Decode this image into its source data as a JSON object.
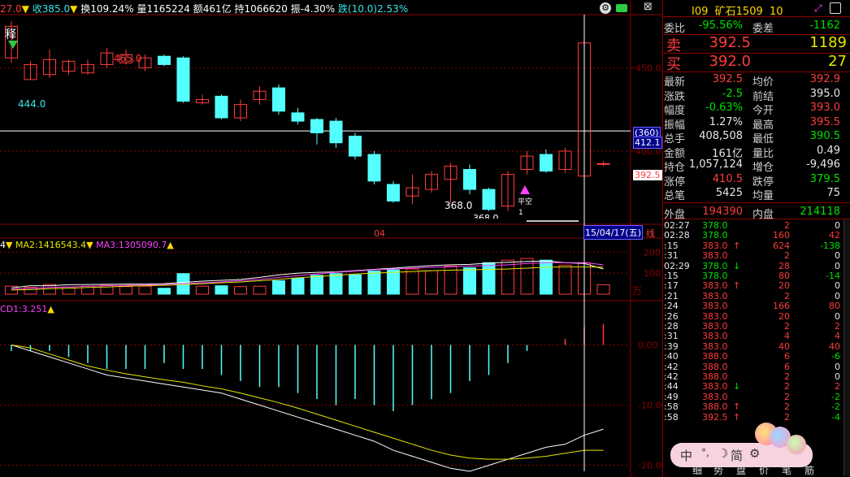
{
  "topbar": {
    "prefix": "27.0",
    "close": "收385.0",
    "turnover": "换109.24%",
    "volume": "量1165224",
    "amount": "额461亿",
    "hold": "持1066620",
    "amplitude": "振-4.30%",
    "change": "跌(10.0)2.53%"
  },
  "chart_data": {
    "type": "candlestick",
    "price_axis_ticks": [
      "450.0",
      "400.0"
    ],
    "price_ylim": [
      358,
      482
    ],
    "annotations": {
      "high": "465.0",
      "low_left": "444.0",
      "low_mid": "368.0",
      "low_cut": "368.0",
      "marker_text": "平空",
      "marker_sub": "1",
      "top_left_label": "释",
      "x_month": "04",
      "date_label": "15/04/17(五)",
      "period_label": "线"
    },
    "crosshair": {
      "price_tag": "412.1",
      "count_tag": "(360)",
      "last_price_tag": "392.5"
    },
    "candles": [
      {
        "o": 456,
        "c": 475,
        "h": 478,
        "l": 453
      },
      {
        "o": 443,
        "c": 452,
        "h": 454,
        "l": 443
      },
      {
        "o": 446,
        "c": 455,
        "h": 461,
        "l": 444
      },
      {
        "o": 448,
        "c": 454,
        "h": 455,
        "l": 446
      },
      {
        "o": 447,
        "c": 452,
        "h": 455,
        "l": 446
      },
      {
        "o": 452,
        "c": 459,
        "h": 462,
        "l": 450
      },
      {
        "o": 453,
        "c": 458,
        "h": 461,
        "l": 452
      },
      {
        "o": 450,
        "c": 456,
        "h": 458,
        "l": 448
      },
      {
        "o": 457,
        "c": 452,
        "h": 458,
        "l": 451
      },
      {
        "o": 456,
        "c": 430,
        "h": 457,
        "l": 429
      },
      {
        "o": 429,
        "c": 431,
        "h": 434,
        "l": 428
      },
      {
        "o": 433,
        "c": 420,
        "h": 434,
        "l": 419
      },
      {
        "o": 420,
        "c": 428,
        "h": 431,
        "l": 418
      },
      {
        "o": 431,
        "c": 436,
        "h": 439,
        "l": 428
      },
      {
        "o": 438,
        "c": 424,
        "h": 440,
        "l": 422
      },
      {
        "o": 423,
        "c": 418,
        "h": 426,
        "l": 416
      },
      {
        "o": 419,
        "c": 411,
        "h": 420,
        "l": 404
      },
      {
        "o": 418,
        "c": 405,
        "h": 420,
        "l": 402
      },
      {
        "o": 409,
        "c": 397,
        "h": 411,
        "l": 395
      },
      {
        "o": 398,
        "c": 382,
        "h": 400,
        "l": 380
      },
      {
        "o": 380,
        "c": 370,
        "h": 382,
        "l": 369
      },
      {
        "o": 373,
        "c": 378,
        "h": 386,
        "l": 368
      },
      {
        "o": 377,
        "c": 386,
        "h": 388,
        "l": 375
      },
      {
        "o": 383,
        "c": 391,
        "h": 393,
        "l": 369
      },
      {
        "o": 389,
        "c": 377,
        "h": 392,
        "l": 374
      },
      {
        "o": 377,
        "c": 365,
        "h": 378,
        "l": 364
      },
      {
        "o": 367,
        "c": 386,
        "h": 388,
        "l": 364
      },
      {
        "o": 389,
        "c": 397,
        "h": 400,
        "l": 386
      },
      {
        "o": 398,
        "c": 388,
        "h": 401,
        "l": 387
      },
      {
        "o": 389,
        "c": 400,
        "h": 402,
        "l": 387
      },
      {
        "o": 385,
        "c": 465,
        "h": 475,
        "l": 358
      },
      {
        "o": 392.5,
        "c": 392.5,
        "h": 394,
        "l": 391
      }
    ],
    "volume_header": {
      "ma1": "4",
      "ma2": "MA2:1416543.4",
      "ma3": "MA3:1305090.7"
    },
    "volume_axis_ticks": [
      "200",
      "100",
      "万"
    ],
    "volume_ylim": [
      0,
      240
    ],
    "volumes": [
      38,
      32,
      46,
      34,
      38,
      42,
      36,
      38,
      28,
      98,
      38,
      40,
      36,
      38,
      64,
      76,
      90,
      98,
      92,
      110,
      116,
      120,
      112,
      134,
      126,
      150,
      162,
      170,
      162,
      138,
      150,
      45
    ],
    "vol_ma_a": [
      30,
      40,
      40,
      45,
      46,
      47,
      48,
      48,
      50,
      56,
      62,
      66,
      70,
      80,
      92,
      100,
      104,
      106,
      112,
      118,
      124,
      130,
      136,
      140,
      142,
      148,
      152,
      156,
      158,
      150,
      146,
      120
    ],
    "vol_ma_b": [
      24,
      28,
      32,
      34,
      38,
      40,
      42,
      44,
      46,
      50,
      54,
      58,
      64,
      70,
      80,
      88,
      96,
      104,
      110,
      116,
      120,
      124,
      128,
      130,
      134,
      136,
      140,
      146,
      150,
      150,
      150,
      140
    ],
    "vol_ma_c": [
      20,
      22,
      26,
      28,
      32,
      34,
      38,
      40,
      42,
      46,
      50,
      54,
      58,
      64,
      70,
      78,
      84,
      90,
      96,
      100,
      104,
      108,
      112,
      114,
      116,
      118,
      120,
      124,
      128,
      130,
      130,
      128
    ],
    "macd_header": "CD1:3.251",
    "macd_axis_ticks": [
      "0.00",
      "-10.00",
      "-20.00"
    ],
    "macd_ylim": [
      -21,
      6
    ],
    "macd_hist": [
      -1,
      -1,
      -1,
      -2,
      -3,
      -4,
      -4,
      -4,
      -3,
      -4,
      -4,
      -5,
      -6,
      -7,
      -7,
      -8,
      -9,
      -10,
      -9,
      -10,
      -11,
      -10,
      -9,
      -8,
      -6,
      -5,
      -3,
      -1,
      0,
      1,
      3,
      3.5
    ],
    "macd_dif": [
      0,
      -1,
      -2,
      -3,
      -4,
      -5,
      -5.5,
      -6,
      -6.5,
      -7,
      -7.5,
      -8,
      -9,
      -10,
      -11,
      -12,
      -13,
      -14,
      -15,
      -16,
      -17.5,
      -18.5,
      -19.5,
      -20.5,
      -21,
      -20,
      -19,
      -18,
      -17,
      -16.5,
      -15,
      -14
    ],
    "macd_dea": [
      0,
      -0.5,
      -1.5,
      -2.5,
      -3.5,
      -4.2,
      -4.8,
      -5.3,
      -5.8,
      -6.2,
      -6.8,
      -7.3,
      -8,
      -8.8,
      -9.6,
      -10.5,
      -11.5,
      -12.5,
      -13.5,
      -14.5,
      -15.5,
      -16.5,
      -17.5,
      -18.3,
      -18.8,
      -19,
      -19,
      -18.8,
      -18.5,
      -18,
      -17.5,
      -17.5
    ]
  },
  "quote": {
    "symbol": "I09",
    "name": "矿石1509",
    "flag": "10",
    "weibi_label": "委比",
    "weibi": "-95.56%",
    "weicha_label": "委差",
    "weicha": "-1162",
    "sell_label": "卖",
    "sell_price": "392.5",
    "sell_qty": "1189",
    "buy_label": "买",
    "buy_price": "392.0",
    "buy_qty": "27",
    "stats": [
      {
        "l1": "最新",
        "v1": "392.5",
        "c1": "red",
        "l2": "均价",
        "v2": "392.9",
        "c2": "red"
      },
      {
        "l1": "涨跌",
        "v1": "-2.5",
        "c1": "green",
        "l2": "前结",
        "v2": "395.0",
        "c2": "white"
      },
      {
        "l1": "幅度",
        "v1": "-0.63%",
        "c1": "green",
        "l2": "今开",
        "v2": "393.0",
        "c2": "red"
      },
      {
        "l1": "振幅",
        "v1": "1.27%",
        "c1": "white",
        "l2": "最高",
        "v2": "395.5",
        "c2": "red"
      },
      {
        "l1": "总手",
        "v1": "408,508",
        "c1": "white",
        "l2": "最低",
        "v2": "390.5",
        "c2": "green"
      },
      {
        "l1": "金额",
        "v1": "161亿",
        "c1": "white",
        "l2": "量比",
        "v2": "0.49",
        "c2": "white"
      },
      {
        "l1": "持仓",
        "v1": "1,057,124",
        "c1": "white",
        "l2": "增仓",
        "v2": "-9,496",
        "c2": "white"
      },
      {
        "l1": "涨停",
        "v1": "410.5",
        "c1": "red",
        "l2": "跌停",
        "v2": "379.5",
        "c2": "green"
      },
      {
        "l1": "总笔",
        "v1": "5425",
        "c1": "white",
        "l2": "均量",
        "v2": "75",
        "c2": "white"
      }
    ],
    "outer_label": "外盘",
    "outer": "194390",
    "inner_label": "内盘",
    "inner": "214118"
  },
  "ticks": [
    {
      "t": "02:27",
      "p": "378.0",
      "a": "",
      "q": "2",
      "d": "0",
      "pc": "green",
      "dc": "white"
    },
    {
      "t": "02:28",
      "p": "378.0",
      "a": "",
      "q": "160",
      "d": "42",
      "pc": "green",
      "dc": "red"
    },
    {
      "t": ":15",
      "p": "383.0",
      "a": "↑",
      "q": "624",
      "d": "-138",
      "pc": "red",
      "dc": "green"
    },
    {
      "t": ":31",
      "p": "383.0",
      "a": "",
      "q": "2",
      "d": "0",
      "pc": "red",
      "dc": "white"
    },
    {
      "t": "02:29",
      "p": "378.0",
      "a": "↓",
      "q": "28",
      "d": "0",
      "pc": "green",
      "dc": "white"
    },
    {
      "t": ":15",
      "p": "378.0",
      "a": "",
      "q": "80",
      "d": "-14",
      "pc": "green",
      "dc": "green"
    },
    {
      "t": ":17",
      "p": "383.0",
      "a": "↑",
      "q": "20",
      "d": "0",
      "pc": "red",
      "dc": "white"
    },
    {
      "t": ":21",
      "p": "383.0",
      "a": "",
      "q": "2",
      "d": "0",
      "pc": "red",
      "dc": "white"
    },
    {
      "t": ":24",
      "p": "383.0",
      "a": "",
      "q": "166",
      "d": "80",
      "pc": "red",
      "dc": "red"
    },
    {
      "t": ":26",
      "p": "383.0",
      "a": "",
      "q": "20",
      "d": "0",
      "pc": "red",
      "dc": "white"
    },
    {
      "t": ":28",
      "p": "383.0",
      "a": "",
      "q": "2",
      "d": "2",
      "pc": "red",
      "dc": "red"
    },
    {
      "t": ":31",
      "p": "383.0",
      "a": "",
      "q": "4",
      "d": "4",
      "pc": "red",
      "dc": "red"
    },
    {
      "t": ":39",
      "p": "383.0",
      "a": "",
      "q": "40",
      "d": "40",
      "pc": "red",
      "dc": "red"
    },
    {
      "t": ":40",
      "p": "388.0",
      "a": "",
      "q": "6",
      "d": "-6",
      "pc": "red",
      "dc": "green"
    },
    {
      "t": ":42",
      "p": "388.0",
      "a": "",
      "q": "6",
      "d": "0",
      "pc": "red",
      "dc": "white"
    },
    {
      "t": ":42",
      "p": "388.0",
      "a": "",
      "q": "2",
      "d": "0",
      "pc": "red",
      "dc": "white"
    },
    {
      "t": ":44",
      "p": "383.0",
      "a": "↓",
      "q": "2",
      "d": "2",
      "pc": "red",
      "dc": "red"
    },
    {
      "t": ":49",
      "p": "383.0",
      "a": "",
      "q": "2",
      "d": "-2",
      "pc": "red",
      "dc": "green"
    },
    {
      "t": ":58",
      "p": "388.0",
      "a": "↑",
      "q": "2",
      "d": "-2",
      "pc": "red",
      "dc": "green"
    },
    {
      "t": ":58",
      "p": "392.5",
      "a": "↑",
      "q": "2",
      "d": "-4",
      "pc": "red",
      "dc": "green"
    }
  ],
  "ime": {
    "lang": "中",
    "punct": "°,",
    "moon": "☽",
    "mode": "简",
    "gear": "⚙"
  },
  "bottom_tabs": [
    "细",
    "势",
    "盘",
    "价",
    "笔",
    "筋"
  ],
  "colors": {
    "up": "#ff3b3b",
    "down_fill": "#54ffff",
    "bg": "#000000",
    "grid": "#8b0000",
    "ma_white": "#ffffff",
    "ma_yellow": "#e6e600",
    "ma_magenta": "#ff40ff",
    "ma_green": "#00e000"
  }
}
